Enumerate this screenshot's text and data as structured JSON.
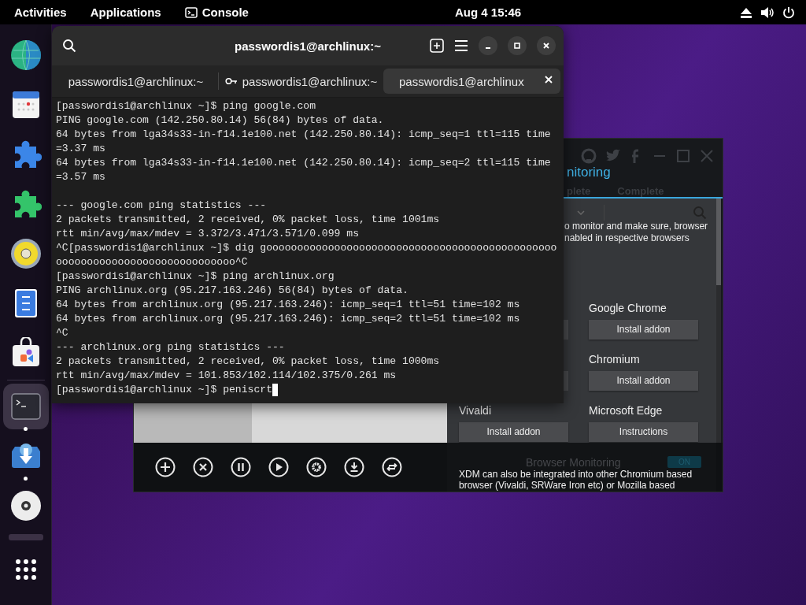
{
  "top_bar": {
    "activities": "Activities",
    "applications": "Applications",
    "app_menu": "Console",
    "clock": "Aug 4  15:46"
  },
  "dock": {
    "items": [
      {
        "running": false,
        "selected": false
      },
      {
        "running": false,
        "selected": false
      },
      {
        "running": false,
        "selected": false
      },
      {
        "running": false,
        "selected": false
      },
      {
        "running": false,
        "selected": false
      },
      {
        "running": false,
        "selected": false
      },
      {
        "running": false,
        "selected": false
      },
      {
        "running": true,
        "selected": true
      },
      {
        "running": true,
        "selected": false
      },
      {
        "running": false,
        "selected": false
      }
    ]
  },
  "terminal": {
    "title": "passwordis1@archlinux:~",
    "tabs": [
      {
        "label": "passwordis1@archlinux:~",
        "selected": false,
        "key": false
      },
      {
        "label": "passwordis1@archlinux:~",
        "selected": false,
        "key": true
      },
      {
        "label": "passwordis1@archlinux",
        "selected": true,
        "key": false
      }
    ],
    "output": "[passwordis1@archlinux ~]$ ping google.com\nPING google.com (142.250.80.14) 56(84) bytes of data.\n64 bytes from lga34s33-in-f14.1e100.net (142.250.80.14): icmp_seq=1 ttl=115 time\n=3.37 ms\n64 bytes from lga34s33-in-f14.1e100.net (142.250.80.14): icmp_seq=2 ttl=115 time\n=3.57 ms\n\n--- google.com ping statistics ---\n2 packets transmitted, 2 received, 0% packet loss, time 1001ms\nrtt min/avg/max/mdev = 3.372/3.471/3.571/0.099 ms\n^C[passwordis1@archlinux ~]$ dig gooooooooooooooooooooooooooooooooooooooooooooooo\nooooooooooooooooooooooooooooo^C\n[passwordis1@archlinux ~]$ ping archlinux.org\nPING archlinux.org (95.217.163.246) 56(84) bytes of data.\n64 bytes from archlinux.org (95.217.163.246): icmp_seq=1 ttl=51 time=102 ms\n64 bytes from archlinux.org (95.217.163.246): icmp_seq=2 ttl=51 time=102 ms\n^C\n--- archlinux.org ping statistics ---\n2 packets transmitted, 2 received, 0% packet loss, time 1000ms\nrtt min/avg/max/mdev = 101.853/102.114/102.375/0.261 ms",
    "prompt": "[passwordis1@archlinux ~]$ peniscrt"
  },
  "xdm": {
    "title": "nitoring",
    "tabs": [
      "plete",
      "Complete"
    ],
    "notice_lines": [
      "o monitor and make sure, browser",
      "nabled in respective browsers"
    ],
    "browsers": [
      {
        "name": "Google Chrome",
        "button": "Install addon"
      },
      {
        "name": "Chromium",
        "button": "Install addon"
      },
      {
        "name": "Vivaldi",
        "button": "Install addon"
      },
      {
        "name": "Microsoft Edge",
        "button": "Instructions"
      }
    ],
    "monitoring": {
      "label": "Browser Monitoring",
      "toggle": {
        "label": "ON",
        "on": true
      },
      "description": "XDM can also be integrated into other Chromium based browser (Vivaldi, SRWare Iron etc) or Mozilla based"
    }
  }
}
